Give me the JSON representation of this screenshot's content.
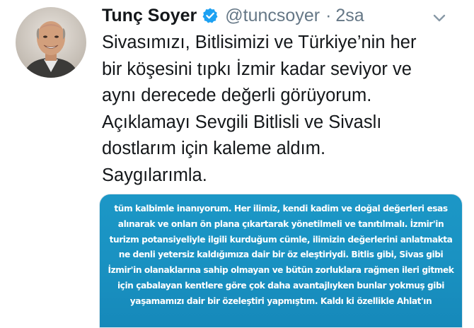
{
  "tweet": {
    "display_name": "Tunç Soyer",
    "handle": "@tuncsoyer",
    "separator": "·",
    "time": "2sa",
    "text_lines": [
      "Sivasımızı, Bitlisimizi ve Türkiye’nin her",
      "bir köşesini tıpkı İzmir kadar seviyor ve",
      "aynı derecede değerli görüyorum.",
      "Açıklamayı Sevgili Bitlisli ve Sivaslı",
      "dostlarım için kaleme aldım.",
      "Saygılarımla."
    ],
    "image_text_lines": [
      "tüm kalbimle inanıyorum. Her ilimiz, kendi kadim ve doğal değerleri esas",
      "alınarak ve onları ön plana çıkartarak yönetilmeli ve tanıtılmalı. İzmir'in",
      "turizm potansiyeliyle ilgili kurduğum cümle, ilimizin değerlerini anlatmakta",
      "ne denli yetersiz kaldığımıza dair bir öz eleştiriydi. Bitlis gibi, Sivas gibi",
      "İzmir'in olanaklarına sahip olmayan ve bütün zorluklara rağmen ileri gitmek",
      "için çabalayan kentlere göre çok daha avantajlıyken bunlar yokmuş gibi",
      "yaşamamızı dair bir özeleştiri yapmıştım. Kaldı ki özellikle Ahlat'ın"
    ],
    "icons": {
      "avatar": "avatar",
      "verified": "verified-badge-icon",
      "caret": "chevron-down-icon"
    },
    "colors": {
      "verified": "#1da1f2",
      "secondary_text": "#657786",
      "image_background": "#1a93c3"
    }
  }
}
